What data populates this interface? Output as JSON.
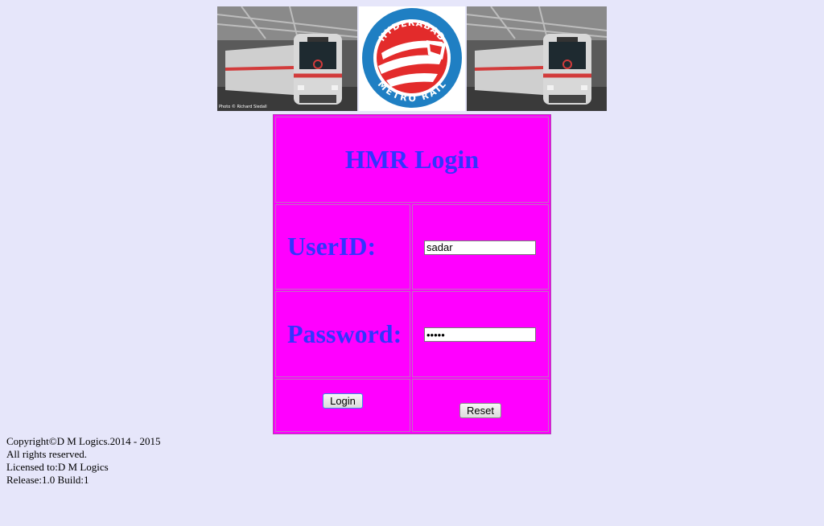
{
  "banner": {
    "photo_credit": "Photo © Richard Siedall",
    "logo": {
      "top_text": "HYDERABAD",
      "bottom_text": "METRO RAIL"
    },
    "colors": {
      "logo_blue": "#1f7fc3",
      "logo_red": "#e32b2b"
    }
  },
  "login": {
    "title": "HMR Login",
    "userid_label": "UserID:",
    "userid_value": "sadar",
    "password_label": "Password:",
    "password_value": "•••••",
    "login_button": "Login",
    "reset_button": "Reset"
  },
  "footer": {
    "copyright": "Copyright©D M Logics.2014 - 2015",
    "rights": "All rights reserved.",
    "license": "Licensed to:D M Logics",
    "release": "Release:1.0 Build:1"
  },
  "colors": {
    "page_bg": "#e6e6fa",
    "panel_bg": "#ff00ff",
    "label_text": "#3333ff"
  }
}
